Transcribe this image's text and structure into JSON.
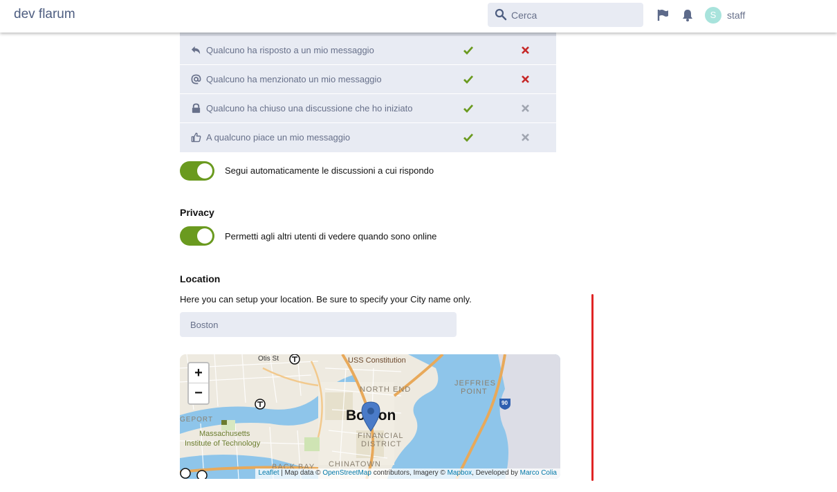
{
  "header": {
    "brand": "dev flarum",
    "search_placeholder": "Cerca",
    "flag_icon": "flag-icon",
    "bell_icon": "bell-icon",
    "avatar_letter": "S",
    "username": "staff"
  },
  "notifications": {
    "rows": [
      {
        "icon": "reply-icon",
        "label": "Qualcuno ha risposto a un mio messaggio",
        "web": "enabled",
        "email": "enabled"
      },
      {
        "icon": "at-icon",
        "label": "Qualcuno ha menzionato un mio messaggio",
        "web": "enabled",
        "email": "enabled"
      },
      {
        "icon": "lock-icon",
        "label": "Qualcuno ha chiuso una discussione che ho iniziato",
        "web": "enabled",
        "email": "disabled"
      },
      {
        "icon": "thumbs-up-icon",
        "label": "A qualcuno piace un mio messaggio",
        "web": "enabled",
        "email": "disabled"
      }
    ],
    "colors": {
      "check": "#6a9a1f",
      "cross_active": "#c62828",
      "cross_inactive": "#a0a5b0"
    }
  },
  "follow_toggle": {
    "label": "Segui automaticamente le discussioni a cui rispondo",
    "on": true
  },
  "privacy": {
    "title": "Privacy",
    "toggle_label": "Permetti agli altri utenti di vedere quando sono online",
    "on": true
  },
  "location": {
    "title": "Location",
    "help": "Here you can setup your location. Be sure to specify your City name only.",
    "value": "Boston"
  },
  "map": {
    "zoom_in": "+",
    "zoom_out": "−",
    "labels": {
      "otis": "Otis St",
      "uss": "USS Constitution",
      "north_end": "NORTH END",
      "jeffries1": "JEFFRIES",
      "jeffries2": "POINT",
      "highway": "90",
      "city": "Boston",
      "bridgeport": "GEPORT",
      "mit1": "Massachusetts",
      "mit2": "Institute of Technology",
      "financial1": "FINANCIAL",
      "financial2": "DISTRICT",
      "backbay": "BACK BAY",
      "chinatown": "CHINATOWN"
    },
    "attribution": {
      "leaflet": "Leaflet",
      "sep": " | Map data © ",
      "osm": "OpenStreetMap",
      "contrib": " contributors, Imagery © ",
      "mapbox": "Mapbox",
      "dev": ", Developed by ",
      "author": "Marco Colia"
    },
    "colors": {
      "water": "#8ec5ea",
      "land": "#eeeae0",
      "highway": "#e8a95a",
      "marker": "#4a7bc8"
    }
  }
}
